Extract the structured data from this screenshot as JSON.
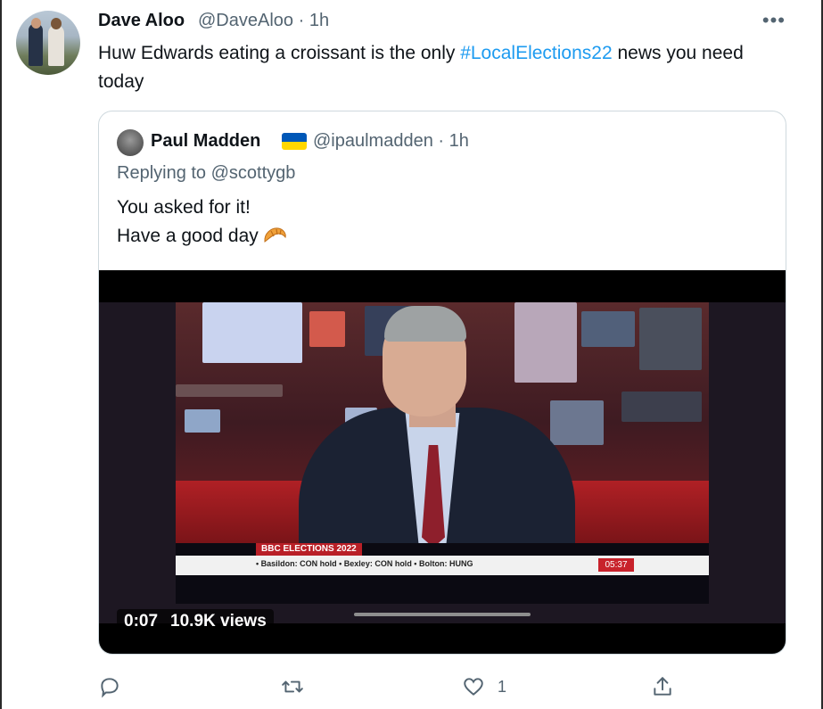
{
  "tweet": {
    "author_name": "Dave Aloo",
    "author_handle": "@DaveAloo",
    "separator": "·",
    "time": "1h",
    "text_part1": "Huw Edwards eating a croissant is the only ",
    "hashtag": "#LocalElections22",
    "text_part2": " news you need today"
  },
  "quoted_tweet": {
    "author_name": "Paul Madden",
    "flag_icon": "ukraine-flag-icon",
    "author_handle": "@ipaulmadden",
    "separator": "·",
    "time": "1h",
    "replying_to": "Replying to @scottygb",
    "line1": "You asked for it!",
    "line2": "Have a good day",
    "emoji_icon": "croissant-icon"
  },
  "video": {
    "duration": "0:07",
    "views": "10.9K views",
    "ticker_title": "BBC ELECTIONS 2022",
    "ticker_text": "• Basildon: CON hold  • Bexley: CON hold  • Bolton: HUNG",
    "ticker_clock": "05:37"
  },
  "actions": {
    "reply_icon": "reply-icon",
    "retweet_icon": "retweet-icon",
    "like_icon": "heart-icon",
    "like_count": "1",
    "share_icon": "share-icon"
  },
  "colors": {
    "link": "#1d9bf0",
    "secondary_text": "#536471",
    "border": "#cfd9de",
    "bbc_red": "#c8222b"
  }
}
